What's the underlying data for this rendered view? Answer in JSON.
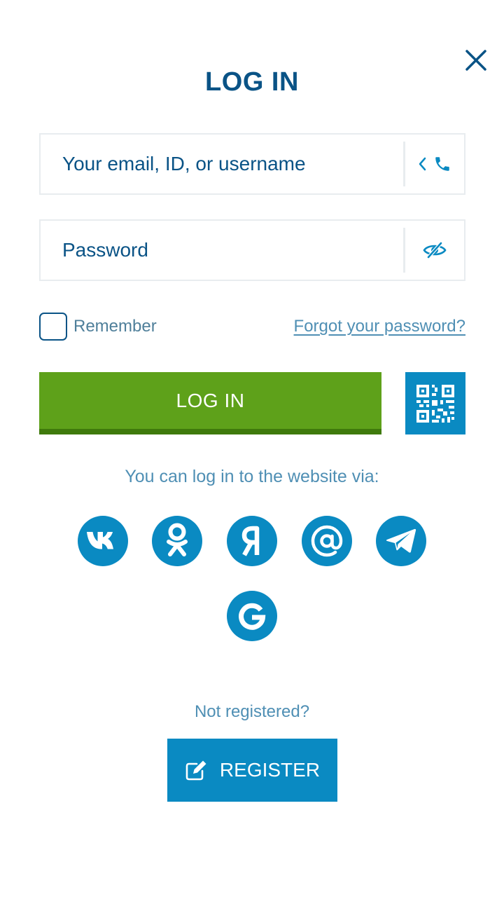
{
  "header": {
    "title": "LOG IN",
    "close_icon": "close-icon"
  },
  "form": {
    "login_placeholder": "Your email, ID, or username",
    "login_value": "",
    "login_toggle_icons": [
      "chevron-left-icon",
      "phone-icon"
    ],
    "password_placeholder": "Password",
    "password_value": "",
    "password_toggle_icon": "eye-hidden-icon",
    "remember_label": "Remember",
    "remember_checked": false,
    "forgot_label": "Forgot your password?",
    "login_button_label": "LOG IN",
    "qr_icon": "qr-code-icon"
  },
  "social": {
    "prompt": "You can log in to the website via:",
    "providers": [
      {
        "name": "VK",
        "icon": "vk-icon"
      },
      {
        "name": "Odnoklassniki",
        "icon": "ok-icon"
      },
      {
        "name": "Yandex",
        "icon": "yandex-icon"
      },
      {
        "name": "Mail.ru",
        "icon": "at-sign-icon"
      },
      {
        "name": "Telegram",
        "icon": "telegram-icon"
      },
      {
        "name": "Google",
        "icon": "google-icon"
      }
    ]
  },
  "register": {
    "prompt": "Not registered?",
    "button_label": "REGISTER",
    "icon": "edit-icon"
  },
  "colors": {
    "primary": "#0a8ac2",
    "title": "#0a5386",
    "login_button": "#5ea11a",
    "link": "#4f8fb4"
  }
}
